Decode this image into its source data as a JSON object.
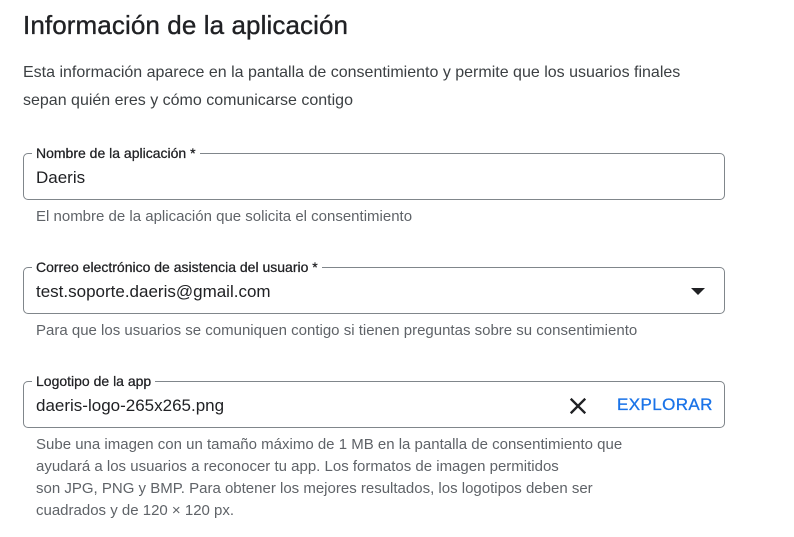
{
  "section": {
    "title": "Información de la aplicación",
    "description": "Esta información aparece en la pantalla de consentimiento y permite que los usuarios finales sepan quién eres y cómo comunicarse contigo"
  },
  "app_name": {
    "label": "Nombre de la aplicación *",
    "value": "Daeris",
    "hint": "El nombre de la aplicación que solicita el consentimiento"
  },
  "support_email": {
    "label": "Correo electrónico de asistencia del usuario *",
    "value": "test.soporte.daeris@gmail.com",
    "hint": "Para que los usuarios se comuniquen contigo si tienen preguntas sobre su consentimiento",
    "icon": "dropdown-arrow-icon"
  },
  "logo": {
    "label": "Logotipo de la app",
    "value": "daeris-logo-265x265.png",
    "browse_label": "EXPLORAR",
    "clear_icon": "close-icon",
    "hint_lines": [
      "Sube una imagen con un tamaño máximo de 1 MB en la pantalla de consentimiento que",
      "ayudará a los usuarios a reconocer tu app. Los formatos de imagen permitidos",
      "son JPG, PNG y BMP. Para obtener los mejores resultados, los logotipos deben ser",
      "cuadrados y de 120 × 120 px."
    ]
  },
  "colors": {
    "accent": "#1a73e8",
    "text": "#202124",
    "hint": "#5f6368",
    "border": "#80868b"
  }
}
